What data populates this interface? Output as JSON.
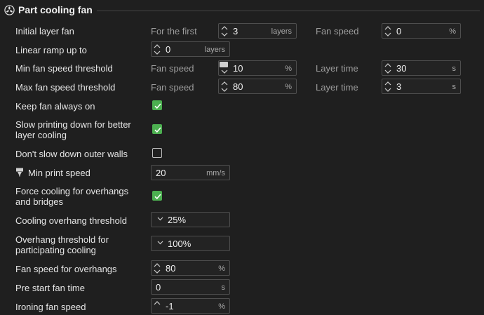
{
  "section": {
    "title": "Part cooling fan",
    "icon": "fan-icon"
  },
  "rows": {
    "initial_layer_fan": {
      "label": "Initial layer fan",
      "sub1": "For the first",
      "value1": "3",
      "unit1": "layers",
      "sub2": "Fan speed",
      "value2": "0",
      "unit2": "%"
    },
    "linear_ramp": {
      "label": "Linear ramp up to",
      "value": "0",
      "unit": "layers"
    },
    "min_threshold": {
      "label": "Min fan speed threshold",
      "sub1": "Fan speed",
      "value1": "10",
      "unit1": "%",
      "sub2": "Layer time",
      "value2": "30",
      "unit2": "s"
    },
    "max_threshold": {
      "label": "Max fan speed threshold",
      "sub1": "Fan speed",
      "value1": "80",
      "unit1": "%",
      "sub2": "Layer time",
      "value2": "3",
      "unit2": "s"
    },
    "keep_fan_on": {
      "label": "Keep fan always on",
      "checked": true
    },
    "slow_printing": {
      "label1": "Slow printing down for better",
      "label2": "layer cooling",
      "checked": true
    },
    "dont_slow_outer": {
      "label": "Don't slow down outer walls",
      "checked": false
    },
    "min_print_speed": {
      "label": "Min print speed",
      "value": "20",
      "unit": "mm/s",
      "icon": "nozzle-icon"
    },
    "force_cooling": {
      "label1": "Force cooling for overhangs",
      "label2": "and bridges",
      "checked": true
    },
    "cooling_overhang": {
      "label": "Cooling overhang threshold",
      "value": "25%"
    },
    "overhang_threshold": {
      "label1": "Overhang threshold for",
      "label2": "participating cooling",
      "value": "100%"
    },
    "fan_speed_overhangs": {
      "label": "Fan speed for overhangs",
      "value": "80",
      "unit": "%"
    },
    "pre_start_fan": {
      "label": "Pre start fan time",
      "value": "0",
      "unit": "s"
    },
    "ironing_fan": {
      "label": "Ironing fan speed",
      "value": "-1",
      "unit": "%"
    }
  },
  "colors": {
    "background": "#1f1f1f",
    "checkbox_on": "#4caf50",
    "border": "#4e4e4e"
  }
}
